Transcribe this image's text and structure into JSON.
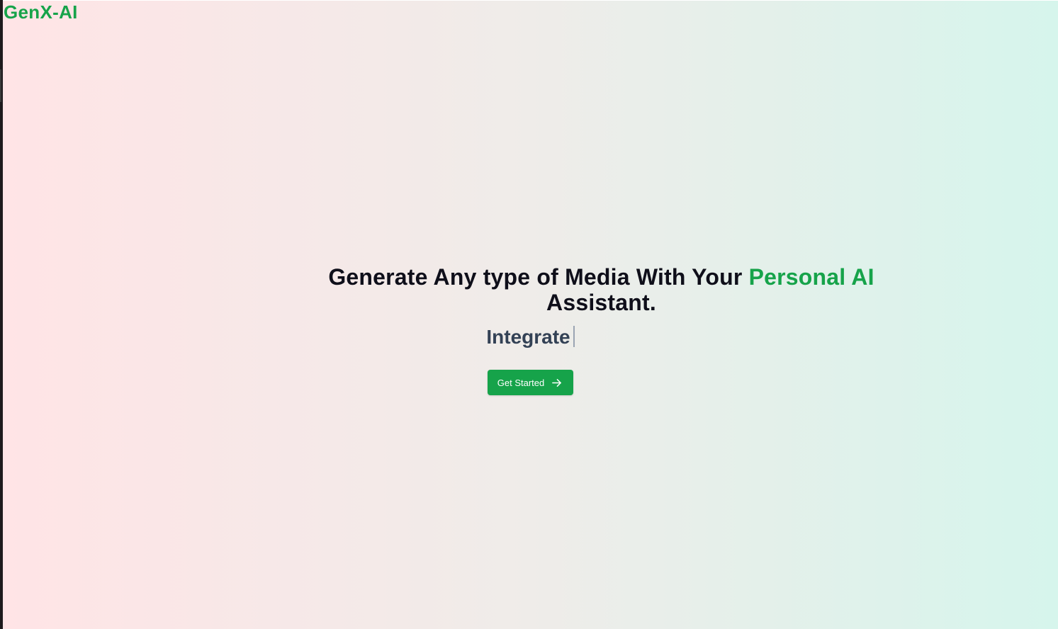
{
  "brand": {
    "name": "GenX-AI"
  },
  "hero": {
    "headline_main": "Generate Any type of Media With Your",
    "headline_accent": "Personal AI",
    "headline_tail": "Assistant.",
    "typed_word": "Integrate",
    "cta_label": "Get Started",
    "cta_icon": "arrow-right-icon"
  },
  "colors": {
    "brand_green": "#16a34a",
    "headline_text": "#0f0f1a",
    "typed_text": "#334155",
    "gradient_start": "#ffe4e6",
    "gradient_end": "#d6f5ec"
  }
}
